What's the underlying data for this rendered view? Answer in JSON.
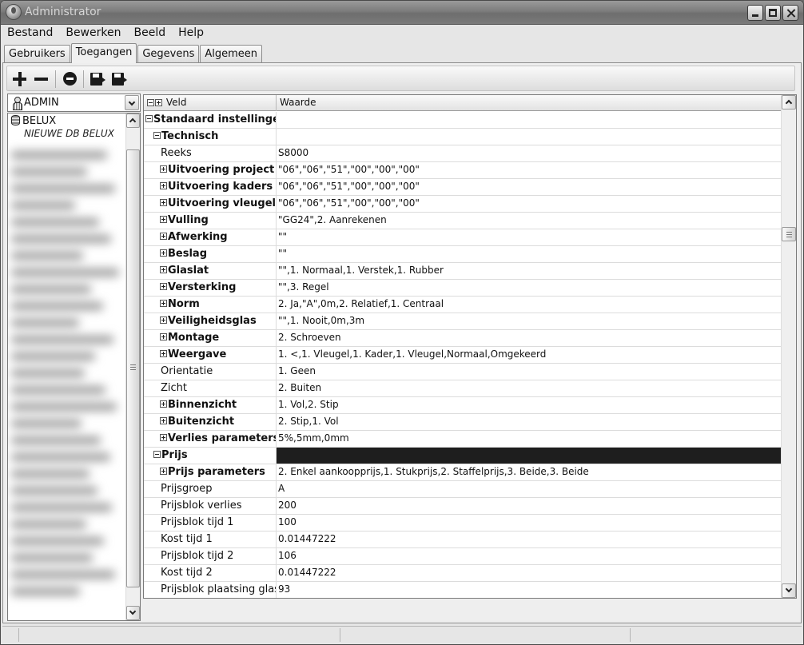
{
  "window": {
    "title": "Administrator"
  },
  "menu": [
    "Bestand",
    "Bewerken",
    "Beeld",
    "Help"
  ],
  "tabs": [
    {
      "label": "Gebruikers",
      "active": false
    },
    {
      "label": "Toegangen",
      "active": true
    },
    {
      "label": "Gegevens",
      "active": false
    },
    {
      "label": "Algemeen",
      "active": false
    }
  ],
  "toolbar": {
    "icons": [
      "plus-icon",
      "minus-icon",
      "stop-icon",
      "save-export-icon",
      "save-import-icon"
    ]
  },
  "user_select": {
    "value": "ADMIN"
  },
  "databases": {
    "main": "BELUX",
    "sub": "NIEUWE DB BELUX"
  },
  "grid": {
    "col_field": "Veld",
    "col_value": "Waarde",
    "rows": [
      {
        "name": "Standaard instellingen",
        "value": "",
        "level": 0,
        "expander": "minus",
        "bold": true,
        "selected": false
      },
      {
        "name": "Technisch",
        "value": "",
        "level": 1,
        "expander": "minus",
        "bold": true,
        "selected": false
      },
      {
        "name": "Reeks",
        "value": "S8000",
        "level": 2,
        "expander": "none",
        "bold": false,
        "selected": false
      },
      {
        "name": "Uitvoering project",
        "value": "\"06\",\"06\",\"51\",\"00\",\"00\",\"00\"",
        "level": 2,
        "expander": "plus",
        "bold": true,
        "selected": false
      },
      {
        "name": "Uitvoering kaders",
        "value": "\"06\",\"06\",\"51\",\"00\",\"00\",\"00\"",
        "level": 2,
        "expander": "plus",
        "bold": true,
        "selected": false
      },
      {
        "name": "Uitvoering vleugels",
        "value": "\"06\",\"06\",\"51\",\"00\",\"00\",\"00\"",
        "level": 2,
        "expander": "plus",
        "bold": true,
        "selected": false
      },
      {
        "name": "Vulling",
        "value": "\"GG24\",2. Aanrekenen",
        "level": 2,
        "expander": "plus",
        "bold": true,
        "selected": false
      },
      {
        "name": "Afwerking",
        "value": "\"\"",
        "level": 2,
        "expander": "plus",
        "bold": true,
        "selected": false
      },
      {
        "name": "Beslag",
        "value": "\"\"",
        "level": 2,
        "expander": "plus",
        "bold": true,
        "selected": false
      },
      {
        "name": "Glaslat",
        "value": "\"\",1. Normaal,1. Verstek,1. Rubber",
        "level": 2,
        "expander": "plus",
        "bold": true,
        "selected": false
      },
      {
        "name": "Versterking",
        "value": "\"\",3. Regel",
        "level": 2,
        "expander": "plus",
        "bold": true,
        "selected": false
      },
      {
        "name": "Norm",
        "value": "2. Ja,\"A\",0m,2. Relatief,1. Centraal",
        "level": 2,
        "expander": "plus",
        "bold": true,
        "selected": false
      },
      {
        "name": "Veiligheidsglas",
        "value": "\"\",1. Nooit,0m,3m",
        "level": 2,
        "expander": "plus",
        "bold": true,
        "selected": false
      },
      {
        "name": "Montage",
        "value": "2. Schroeven",
        "level": 2,
        "expander": "plus",
        "bold": true,
        "selected": false
      },
      {
        "name": "Weergave",
        "value": "1. <,1. Vleugel,1. Kader,1. Vleugel,Normaal,Omgekeerd",
        "level": 2,
        "expander": "plus",
        "bold": true,
        "selected": false
      },
      {
        "name": "Orientatie",
        "value": "1. Geen",
        "level": 2,
        "expander": "none",
        "bold": false,
        "selected": false
      },
      {
        "name": "Zicht",
        "value": "2. Buiten",
        "level": 2,
        "expander": "none",
        "bold": false,
        "selected": false
      },
      {
        "name": "Binnenzicht",
        "value": "1. Vol,2. Stip",
        "level": 2,
        "expander": "plus",
        "bold": true,
        "selected": false
      },
      {
        "name": "Buitenzicht",
        "value": "2. Stip,1. Vol",
        "level": 2,
        "expander": "plus",
        "bold": true,
        "selected": false
      },
      {
        "name": "Verlies parameters",
        "value": "5%,5mm,0mm",
        "level": 2,
        "expander": "plus",
        "bold": true,
        "selected": false
      },
      {
        "name": "Prijs",
        "value": "",
        "level": 1,
        "expander": "minus",
        "bold": true,
        "selected": true
      },
      {
        "name": "Prijs parameters",
        "value": "2. Enkel aankoopprijs,1. Stukprijs,2. Staffelprijs,3. Beide,3. Beide",
        "level": 2,
        "expander": "plus",
        "bold": true,
        "selected": false
      },
      {
        "name": "Prijsgroep",
        "value": "A",
        "level": 2,
        "expander": "none",
        "bold": false,
        "selected": false
      },
      {
        "name": "Prijsblok verlies",
        "value": "200",
        "level": 2,
        "expander": "none",
        "bold": false,
        "selected": false
      },
      {
        "name": "Prijsblok tijd 1",
        "value": "100",
        "level": 2,
        "expander": "none",
        "bold": false,
        "selected": false
      },
      {
        "name": "Kost tijd 1",
        "value": "0.01447222",
        "level": 2,
        "expander": "none",
        "bold": false,
        "selected": false
      },
      {
        "name": "Prijsblok tijd 2",
        "value": "106",
        "level": 2,
        "expander": "none",
        "bold": false,
        "selected": false
      },
      {
        "name": "Kost tijd 2",
        "value": "0.01447222",
        "level": 2,
        "expander": "none",
        "bold": false,
        "selected": false
      },
      {
        "name": "Prijsblok plaatsing glas",
        "value": "93",
        "level": 2,
        "expander": "none",
        "bold": false,
        "selected": false
      }
    ]
  }
}
